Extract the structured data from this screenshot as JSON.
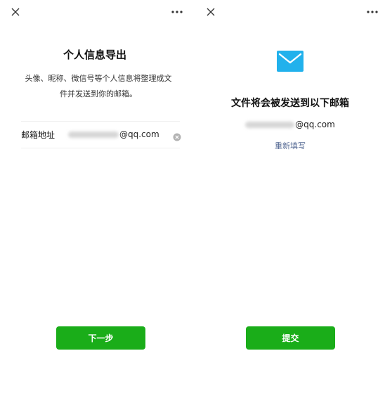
{
  "colors": {
    "primary_button": "#1aad19",
    "link": "#576b95",
    "envelope": "#21b1ec"
  },
  "icons": {
    "close": "close-icon",
    "more": "more-icon",
    "clear": "clear-icon",
    "envelope": "envelope-icon"
  },
  "left_screen": {
    "title": "个人信息导出",
    "description_line1": "头像、昵称、微信号等个人信息将整理成文",
    "description_line2": "件并发送到你的邮箱。",
    "email_label": "邮箱地址",
    "email_value_visible": "@qq.com",
    "next_button": "下一步"
  },
  "right_screen": {
    "title": "文件将会被发送到以下邮箱",
    "email_value_visible": "@qq.com",
    "refill_link": "重新填写",
    "submit_button": "提交"
  }
}
